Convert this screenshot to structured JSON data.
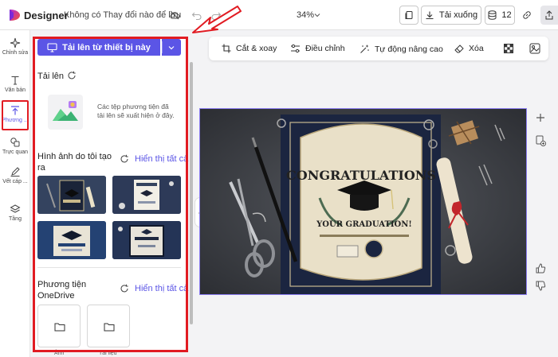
{
  "header": {
    "app_name": "Designer",
    "doc_status": "Không có Thay đổi nào để lưu",
    "zoom": "34%",
    "download_label": "Tải xuống",
    "count_badge": "12"
  },
  "rail": {
    "items": [
      {
        "label": "Chỉnh sửa",
        "icon": "sparkle-icon"
      },
      {
        "label": "Văn bản",
        "icon": "text-icon"
      },
      {
        "label": "Phương ...",
        "icon": "upload-icon"
      },
      {
        "label": "Trực quan",
        "icon": "shapes-icon"
      },
      {
        "label": "Vết cáp ...",
        "icon": "pen-icon"
      },
      {
        "label": "Tầng",
        "icon": "layers-icon"
      }
    ]
  },
  "panel": {
    "upload_button": "Tải lên từ thiết bị này",
    "uploads_title": "Tải lên",
    "uploads_desc": "Các tệp phương tiện đã tải lên sẽ xuất hiện ở đây.",
    "generated_title": "Hình ảnh do tôi tạo ra",
    "show_all_1": "Hiển thị tất cả",
    "onedrive_title": "Phương tiện OneDrive",
    "show_all_2": "Hiển thị tất cả",
    "folders": [
      {
        "label": "Ảnh"
      },
      {
        "label": "Tài liệu"
      }
    ]
  },
  "toolbar": {
    "crop": "Cắt & xoay",
    "adjust": "Điều chỉnh",
    "enhance": "Tự động nâng cao",
    "erase": "Xóa"
  },
  "canvas": {
    "certificate_title": "CONGRATULATIONS",
    "certificate_subtitle": "YOUR GRADUATION!"
  },
  "colors": {
    "accent": "#5b55e6",
    "highlight": "#e11b22"
  }
}
